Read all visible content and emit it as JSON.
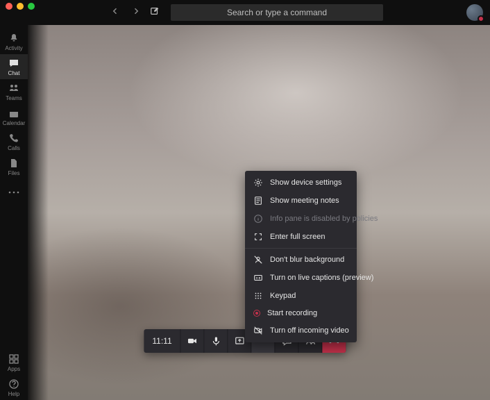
{
  "title_bar": {
    "search_placeholder": "Search or type a command"
  },
  "rail": {
    "items": [
      {
        "id": "activity",
        "label": "Activity"
      },
      {
        "id": "chat",
        "label": "Chat"
      },
      {
        "id": "teams",
        "label": "Teams"
      },
      {
        "id": "calendar",
        "label": "Calendar"
      },
      {
        "id": "calls",
        "label": "Calls"
      },
      {
        "id": "files",
        "label": "Files"
      }
    ],
    "bottom": [
      {
        "id": "apps",
        "label": "Apps"
      },
      {
        "id": "help",
        "label": "Help"
      }
    ],
    "active_id": "chat"
  },
  "call_bar": {
    "duration": "11:11"
  },
  "menu": {
    "group1": [
      {
        "id": "device-settings",
        "label": "Show device settings"
      },
      {
        "id": "meeting-notes",
        "label": "Show meeting notes"
      },
      {
        "id": "info-pane-disabled",
        "label": "Info pane is disabled by policies",
        "disabled": true
      },
      {
        "id": "full-screen",
        "label": "Enter full screen"
      }
    ],
    "group2": [
      {
        "id": "blur-bg",
        "label": "Don't blur background"
      },
      {
        "id": "live-captions",
        "label": "Turn on live captions (preview)"
      },
      {
        "id": "keypad",
        "label": "Keypad"
      },
      {
        "id": "start-recording",
        "label": "Start recording"
      },
      {
        "id": "incoming-video-off",
        "label": "Turn off incoming video"
      }
    ]
  },
  "colors": {
    "hangup": "#c4314b",
    "menu_bg": "#2b2a2f"
  }
}
